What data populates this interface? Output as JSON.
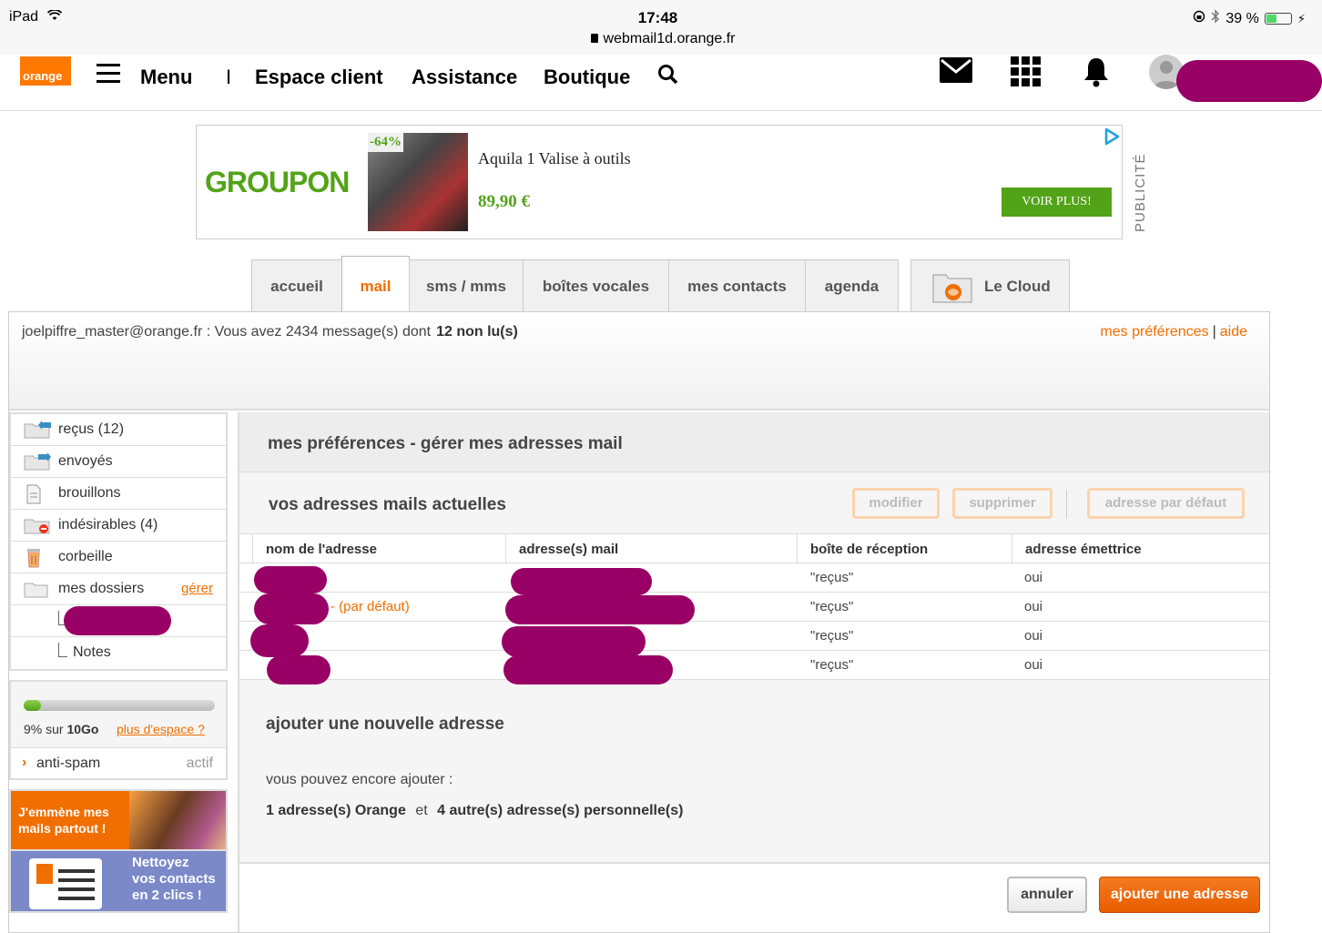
{
  "status_bar": {
    "device": "iPad",
    "time": "17:48",
    "url": "webmail1d.orange.fr",
    "battery": "39 %",
    "battery_level": 0.39
  },
  "header": {
    "logo": "orange",
    "menu": "Menu",
    "separator": "I",
    "nav": [
      "Espace client",
      "Assistance",
      "Boutique"
    ],
    "icons": [
      "search-icon",
      "mail-icon",
      "apps-grid-icon",
      "bell-icon",
      "user-avatar-icon"
    ]
  },
  "ad": {
    "brand": "GROUPON",
    "discount": "-64%",
    "title": "Aquila 1 Valise à outils",
    "price": "89,90 €",
    "cta": "VOIR PLUS!",
    "label": "PUBLICITÉ"
  },
  "tabs": [
    "accueil",
    "mail",
    "sms / mms",
    "boîtes vocales",
    "mes contacts",
    "agenda",
    "Le Cloud"
  ],
  "active_tab": "mail",
  "info": {
    "text": "joelpiffre_master@orange.fr : Vous avez 2434 message(s) dont",
    "unread": "12 non lu(s)",
    "link_prefs": "mes préférences",
    "separator": "|",
    "link_help": "aide"
  },
  "folders": [
    {
      "label": "reçus (12)",
      "icon": "inbox-icon"
    },
    {
      "label": "envoyés",
      "icon": "sent-icon"
    },
    {
      "label": "brouillons",
      "icon": "drafts-icon"
    },
    {
      "label": "indésirables (4)",
      "icon": "spam-folder-icon"
    },
    {
      "label": "corbeille",
      "icon": "trash-icon"
    },
    {
      "label": "mes dossiers",
      "icon": "folder-icon",
      "action": "gérer"
    }
  ],
  "subfolders": [
    "Notes"
  ],
  "quota": {
    "used_percent": 9,
    "text_prefix": "9% sur",
    "total": "10Go",
    "more_link": "plus d'espace ?"
  },
  "antispam": {
    "label": "anti-spam",
    "state": "actif"
  },
  "promos": [
    {
      "lines": [
        "J'emmène mes",
        "mails partout !"
      ]
    },
    {
      "lines": [
        "Nettoyez",
        "vos contacts",
        "en 2 clics !"
      ]
    }
  ],
  "content": {
    "title": "mes préférences - gérer mes adresses mail",
    "subtitle": "vos adresses mails actuelles",
    "buttons": {
      "modify": "modifier",
      "delete": "supprimer",
      "default": "adresse par défaut"
    },
    "table": {
      "headers": [
        "nom de l'adresse",
        "adresse(s) mail",
        "boîte de réception",
        "adresse émettrice"
      ],
      "rows": [
        {
          "name_suffix": "",
          "inbox": "\"reçus\"",
          "sender": "oui"
        },
        {
          "name_suffix": "- (par défaut)",
          "inbox": "\"reçus\"",
          "sender": "oui"
        },
        {
          "name_suffix": "",
          "inbox": "\"reçus\"",
          "sender": "oui"
        },
        {
          "name_suffix": "",
          "inbox": "\"reçus\"",
          "sender": "oui"
        }
      ]
    },
    "add_title": "ajouter une nouvelle adresse",
    "add_text": "vous pouvez encore ajouter :",
    "add_orange": "1 adresse(s) Orange",
    "add_and": "et",
    "add_personal": "4 autre(s) adresse(s) personnelle(s)",
    "cancel": "annuler",
    "add_button": "ajouter une adresse"
  }
}
